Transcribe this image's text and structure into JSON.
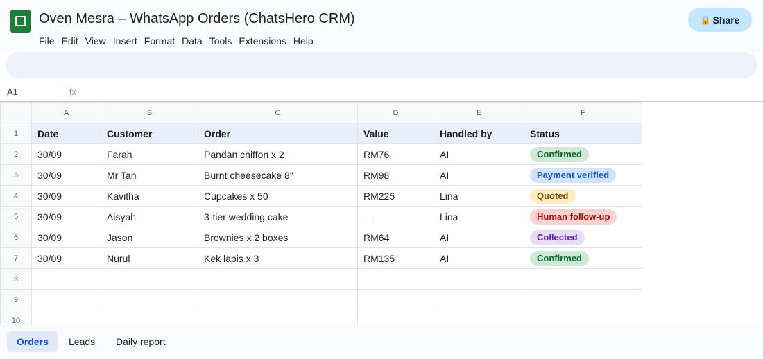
{
  "app": {
    "title": "Oven Mesra – WhatsApp Orders (ChatsHero CRM)",
    "icon": "spreadsheet-icon"
  },
  "menu": [
    "File",
    "Edit",
    "View",
    "Insert",
    "Format",
    "Data",
    "Tools",
    "Extensions",
    "Help"
  ],
  "share": {
    "label": "Share",
    "icon": "lock-icon"
  },
  "formula_bar": {
    "cell_ref": "A1",
    "fx": "fx",
    "value": ""
  },
  "grid": {
    "column_letters": [
      "A",
      "B",
      "C",
      "D",
      "E",
      "F"
    ],
    "row_numbers": [
      "1",
      "2",
      "3",
      "4",
      "5",
      "6",
      "7",
      "8",
      "9",
      "10"
    ],
    "headers": [
      "Date",
      "Customer",
      "Order",
      "Value",
      "Handled by",
      "Status"
    ],
    "rows": [
      {
        "date": "30/09",
        "customer": "Farah",
        "order": "Pandan chiffon x 2",
        "value": "RM76",
        "handled_by": "AI",
        "status": "Confirmed",
        "status_color": "green"
      },
      {
        "date": "30/09",
        "customer": "Mr Tan",
        "order": "Burnt cheesecake 8\"",
        "value": "RM98",
        "handled_by": "AI",
        "status": "Payment verified",
        "status_color": "blue"
      },
      {
        "date": "30/09",
        "customer": "Kavitha",
        "order": "Cupcakes x 50",
        "value": "RM225",
        "handled_by": "Lina",
        "status": "Quoted",
        "status_color": "yellow"
      },
      {
        "date": "30/09",
        "customer": "Aisyah",
        "order": "3-tier wedding cake",
        "value": "—",
        "handled_by": "Lina",
        "status": "Human follow-up",
        "status_color": "red"
      },
      {
        "date": "30/09",
        "customer": "Jason",
        "order": "Brownies x 2 boxes",
        "value": "RM64",
        "handled_by": "AI",
        "status": "Collected",
        "status_color": "purple"
      },
      {
        "date": "30/09",
        "customer": "Nurul",
        "order": "Kek lapis x 3",
        "value": "RM135",
        "handled_by": "AI",
        "status": "Confirmed",
        "status_color": "green"
      }
    ]
  },
  "sheet_tabs": [
    {
      "label": "Orders",
      "active": true
    },
    {
      "label": "Leads",
      "active": false
    },
    {
      "label": "Daily report",
      "active": false
    }
  ],
  "colors": {
    "brand_green": "#188038",
    "share_bg": "#c2e7ff",
    "header_row_bg": "#e8f0fe",
    "active_tab": "#0b57d0"
  }
}
